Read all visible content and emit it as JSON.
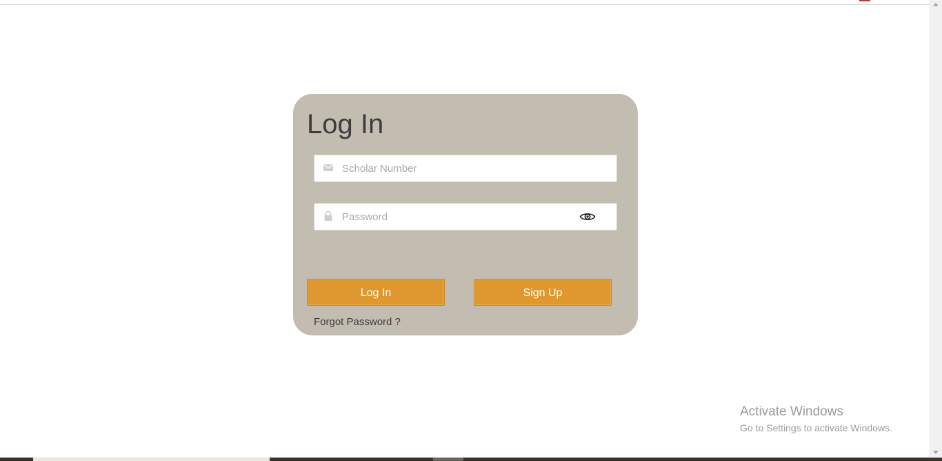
{
  "login_card": {
    "title": "Log In",
    "scholar_field": {
      "placeholder": "Scholar Number",
      "value": "",
      "icon": "envelope-icon"
    },
    "password_field": {
      "placeholder": "Password",
      "value": "",
      "icon": "lock-icon",
      "toggle_icon": "eye-icon"
    },
    "login_button_label": "Log In",
    "signup_button_label": "Sign Up",
    "forgot_password_label": "Forgot Password ?"
  },
  "watermark": {
    "title": "Activate Windows",
    "subtitle": "Go to Settings to activate Windows."
  },
  "colors": {
    "card_background": "#c3bcb0",
    "button_background": "#df982f",
    "title_text": "#3d3d3d",
    "page_background": "#ffffff"
  }
}
